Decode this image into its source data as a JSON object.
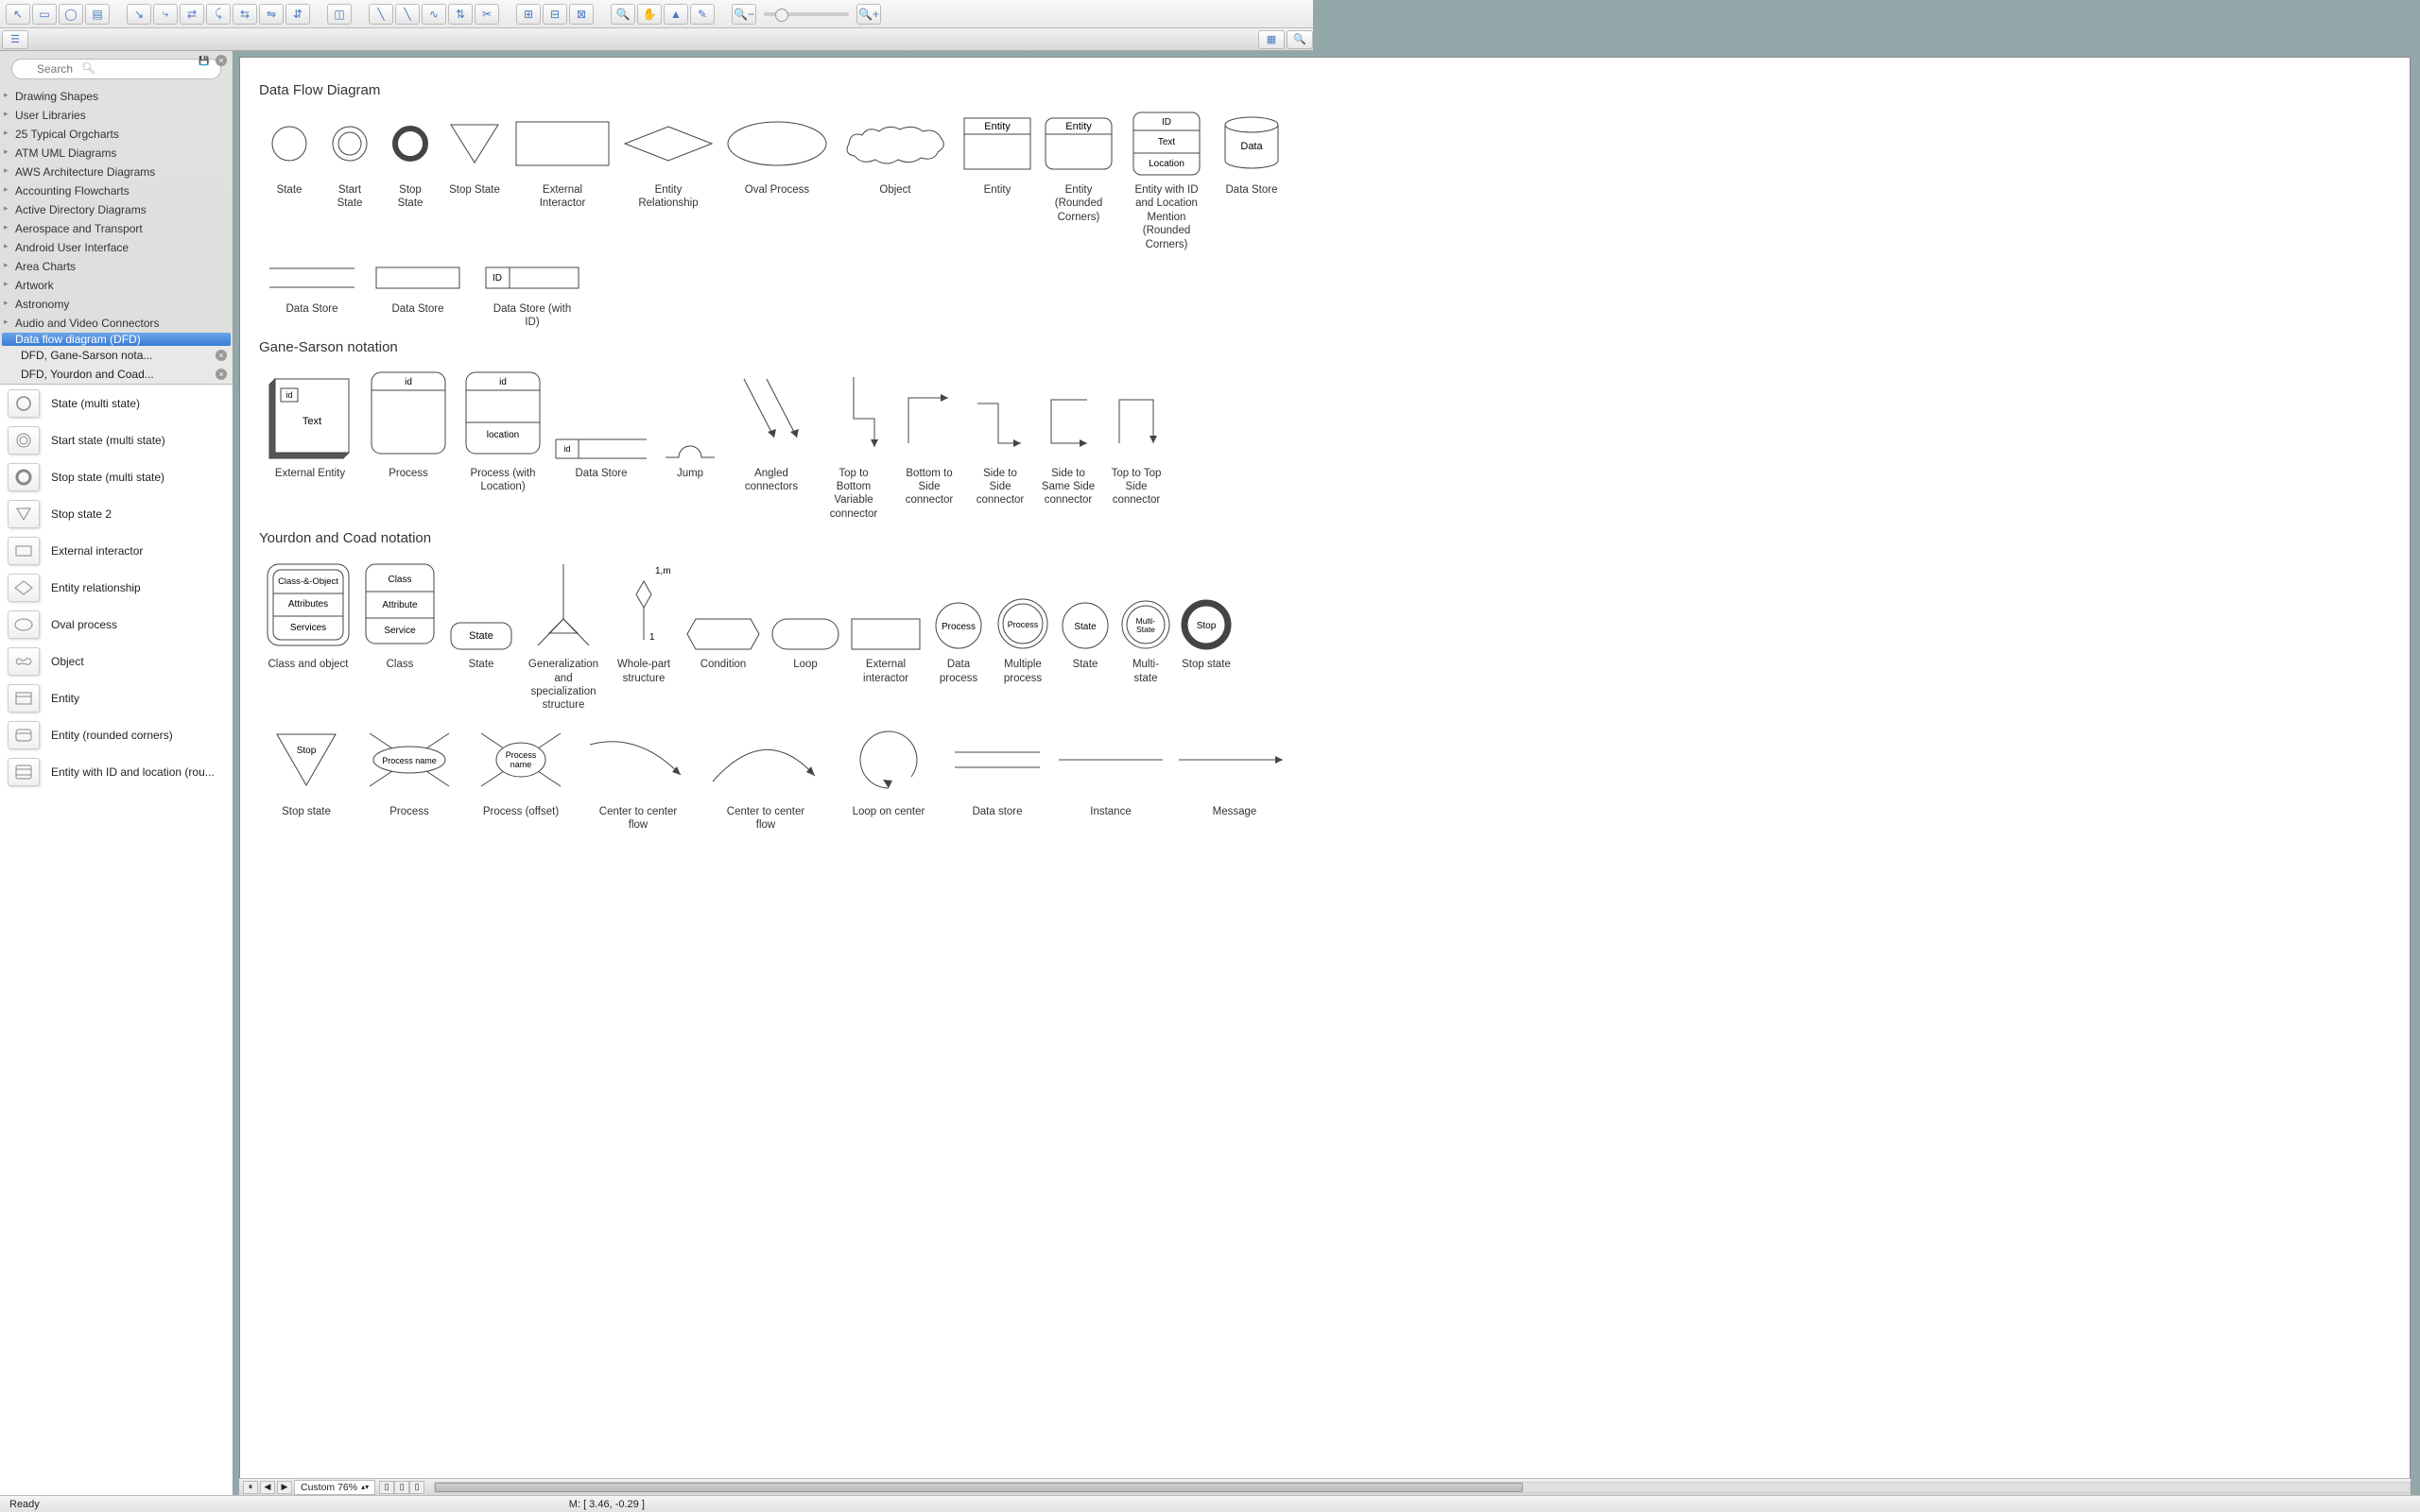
{
  "search": {
    "placeholder": "Search"
  },
  "sidebar": {
    "libraries": [
      "Drawing Shapes",
      "User Libraries",
      "25 Typical Orgcharts",
      "ATM UML Diagrams",
      "AWS Architecture Diagrams",
      "Accounting Flowcharts",
      "Active Directory Diagrams",
      "Aerospace and Transport",
      "Android User Interface",
      "Area Charts",
      "Artwork",
      "Astronomy",
      "Audio and Video Connectors"
    ],
    "selected": "Data flow diagram (DFD)",
    "sublibs": [
      "DFD, Gane-Sarson nota...",
      "DFD, Yourdon and Coad..."
    ],
    "shapes": [
      "State (multi state)",
      "Start state (multi state)",
      "Stop state (multi state)",
      "Stop state 2",
      "External interactor",
      "Entity relationship",
      "Oval process",
      "Object",
      "Entity",
      "Entity (rounded corners)",
      "Entity with ID and location (rou..."
    ]
  },
  "canvas": {
    "section1": {
      "title": "Data Flow Diagram",
      "row1": [
        {
          "label": "State"
        },
        {
          "label": "Start State"
        },
        {
          "label": "Stop State"
        },
        {
          "label": "Stop State"
        },
        {
          "label": "External Interactor"
        },
        {
          "label": "Entity Relationship"
        },
        {
          "label": "Oval Process"
        },
        {
          "label": "Object"
        },
        {
          "label": "Entity",
          "intext": "Entity"
        },
        {
          "label": "Entity (Rounded Corners)",
          "intext": "Entity"
        },
        {
          "label": "Entity with ID and Location Mention (Rounded Corners)",
          "t1": "ID",
          "t2": "Text",
          "t3": "Location"
        },
        {
          "label": "Data Store",
          "intext": "Data"
        }
      ],
      "row2": [
        {
          "label": "Data Store"
        },
        {
          "label": "Data Store"
        },
        {
          "label": "Data Store (with ID)",
          "intext": "ID"
        }
      ]
    },
    "section2": {
      "title": "Gane-Sarson notation",
      "row1": [
        {
          "label": "External Entity",
          "t1": "id",
          "t2": "Text"
        },
        {
          "label": "Process",
          "t1": "id"
        },
        {
          "label": "Process (with Location)",
          "t1": "id",
          "t2": "location"
        },
        {
          "label": "Data Store",
          "t1": "id"
        },
        {
          "label": "Jump"
        },
        {
          "label": "Angled connectors"
        },
        {
          "label": "Top to Bottom Variable connector"
        },
        {
          "label": "Bottom to Side connector"
        },
        {
          "label": "Side to Side connector"
        },
        {
          "label": "Side to Same Side connector"
        },
        {
          "label": "Top to Top Side connector"
        }
      ]
    },
    "section3": {
      "title": "Yourdon and Coad notation",
      "row1": [
        {
          "label": "Class and object",
          "t1": "Class-&-Object",
          "t2": "Attributes",
          "t3": "Services"
        },
        {
          "label": "Class",
          "t1": "Class",
          "t2": "Attribute",
          "t3": "Service"
        },
        {
          "label": "State",
          "intext": "State"
        },
        {
          "label": "Generalization and specialization structure"
        },
        {
          "label": "Whole-part structure",
          "t1": "1,m",
          "t2": "1"
        },
        {
          "label": "Condition"
        },
        {
          "label": "Loop"
        },
        {
          "label": "External interactor"
        },
        {
          "label": "Data process",
          "intext": "Process"
        },
        {
          "label": "Multiple process",
          "intext": "Process"
        },
        {
          "label": "State",
          "intext": "State"
        },
        {
          "label": "Multi-state",
          "intext": "Multi-State"
        },
        {
          "label": "Stop state",
          "intext": "Stop"
        }
      ],
      "row2": [
        {
          "label": "Stop state",
          "intext": "Stop"
        },
        {
          "label": "Process",
          "intext": "Process name"
        },
        {
          "label": "Process (offset)",
          "intext": "Process name"
        },
        {
          "label": "Center to center flow"
        },
        {
          "label": "Center to center flow"
        },
        {
          "label": "Loop on center"
        },
        {
          "label": "Data store"
        },
        {
          "label": "Instance"
        },
        {
          "label": "Message"
        }
      ]
    }
  },
  "bottombar": {
    "zoom": "Custom 76%"
  },
  "status": {
    "ready": "Ready",
    "m": "M: [ 3.46, -0.29 ]"
  }
}
